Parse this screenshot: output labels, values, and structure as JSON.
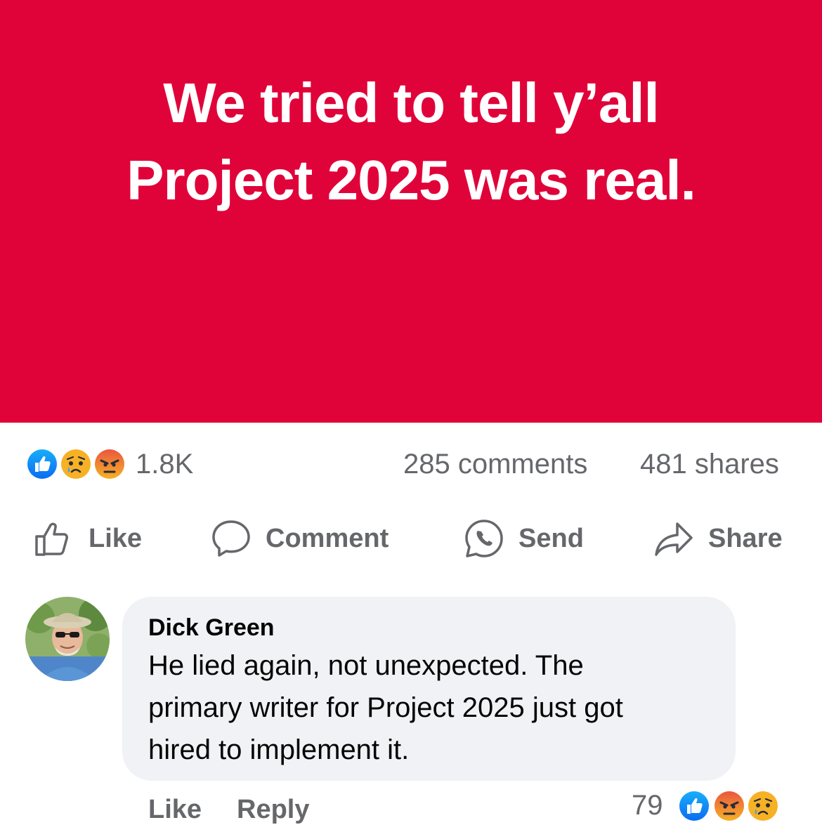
{
  "banner": {
    "line1": "We tried to tell y’all",
    "line2": "Project 2025 was real.",
    "background": "#e0033a"
  },
  "post_stats": {
    "reactions": [
      "like-icon",
      "sad-icon",
      "angry-icon"
    ],
    "reaction_count": "1.8K",
    "comments": "285 comments",
    "shares": "481 shares"
  },
  "actions": {
    "like": "Like",
    "comment": "Comment",
    "send": "Send",
    "share": "Share"
  },
  "comment": {
    "author": "Dick Green",
    "lines": [
      "He lied again, not unexpected. The",
      "primary writer for Project 2025 just got",
      "hired to implement it."
    ],
    "like": "Like",
    "reply": "Reply",
    "reaction_count": "79",
    "reactions": [
      "like-icon",
      "angry-icon",
      "sad-icon"
    ]
  },
  "colors": {
    "like_blue": "#1877f2",
    "emoji_yellow": "#f7b125",
    "angry_red": "#e9573f",
    "muted_text": "#65676b",
    "bubble": "#f0f2f5"
  }
}
